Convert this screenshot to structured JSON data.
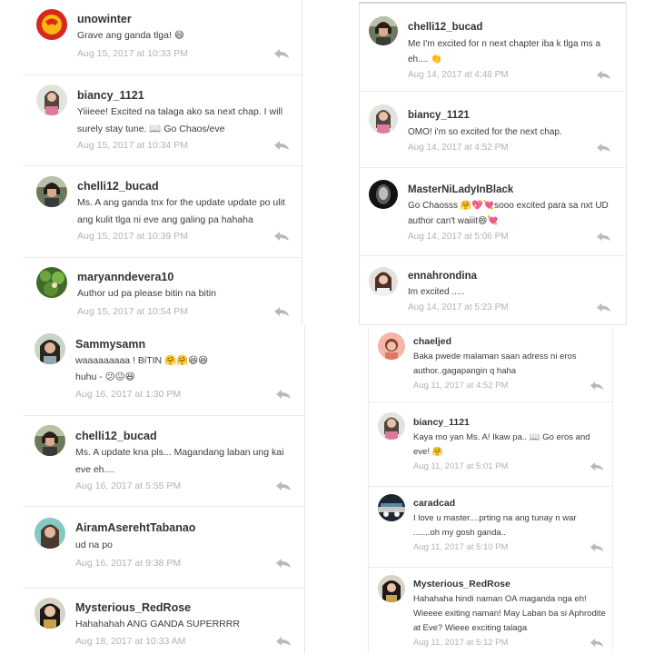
{
  "colors": {
    "date": "#b2b2b2",
    "username": "#333333",
    "text": "#3c3c3c",
    "divider": "#ececec"
  },
  "icons": {
    "reply": "reply-arrow-icon",
    "emoji": "emoji-icon"
  },
  "panels": [
    {
      "comments": [
        {
          "username": "unowinter",
          "text": "Grave ang ganda tlga! 😄",
          "date": "Aug 15, 2017 at 10:33 PM"
        },
        {
          "username": "biancy_1121",
          "text": "Yiiieee! Excited na talaga ako sa next chap. I will surely stay tune. 📖 Go Chaos/eve",
          "date": "Aug 15, 2017 at 10:34 PM"
        },
        {
          "username": "chelli12_bucad",
          "text": "Ms. A ang ganda tnx for the update update po ulit ang kulit tlga ni eve ang galing pa hahaha",
          "date": "Aug 15, 2017 at 10:39 PM"
        },
        {
          "username": "maryanndevera10",
          "text": "Author ud pa please bitin na bitin",
          "date": "Aug 15, 2017 at 10:54 PM"
        }
      ]
    },
    {
      "comments": [
        {
          "username": "chelli12_bucad",
          "text": "Me I'm excited for n next chapter iba k tlga ms a eh.... 👏",
          "date": "Aug 14, 2017 at 4:48 PM"
        },
        {
          "username": "biancy_1121",
          "text": "OMO! i'm so excited for the next chap.",
          "date": "Aug 14, 2017 at 4:52 PM"
        },
        {
          "username": "MasterNiLadyInBlack",
          "text": "Go Chaosss 🤗💖💘sooo excited para sa nxt UD author can't waiiit😄💘",
          "date": "Aug 14, 2017 at 5:06 PM"
        },
        {
          "username": "ennahrondina",
          "text": "Im excited .....",
          "date": "Aug 14, 2017 at 5:23 PM"
        }
      ]
    },
    {
      "comments": [
        {
          "username": "Sammysamn",
          "text": "waaaaaaaaa ! BiTIN 🤗🤗😆😆",
          "text2": "huhu - 😕😖😆",
          "date": "Aug 16, 2017 at 1:30 PM"
        },
        {
          "username": "chelli12_bucad",
          "text": "Ms. A update kna pls... Magandang laban ung kai eve eh....",
          "date": "Aug 16, 2017 at 5:55 PM"
        },
        {
          "username": "AiramAserehtTabanao",
          "text": "ud na po",
          "date": "Aug 16, 2017 at 9:38 PM"
        },
        {
          "username": "Mysterious_RedRose",
          "text": "Hahahahah ANG GANDA SUPERRRR",
          "date": "Aug 18, 2017 at 10:33 AM"
        }
      ]
    },
    {
      "comments": [
        {
          "username": "chaeljed",
          "text": "Baka pwede malaman saan adress ni eros author..gagapangin q haha",
          "date": "Aug 11, 2017 at 4:52 PM"
        },
        {
          "username": "biancy_1121",
          "text": "Kaya mo yan Ms. A! Ikaw pa.. 📖 Go eros and eve! 🤗",
          "date": "Aug 11, 2017 at 5:01 PM"
        },
        {
          "username": "caradcad",
          "text": "I love u master....prting na ang tunay n war .......oh my gosh ganda..",
          "date": "Aug 11, 2017 at 5:10 PM"
        },
        {
          "username": "Mysterious_RedRose",
          "text": "Hahahaha hindi naman OA maganda nga eh! Wieeee exiting naman!  May Laban ba si Aphrodite at Eve?  Wieee exciting talaga",
          "date": "Aug 11, 2017 at 5:12 PM"
        }
      ]
    }
  ]
}
